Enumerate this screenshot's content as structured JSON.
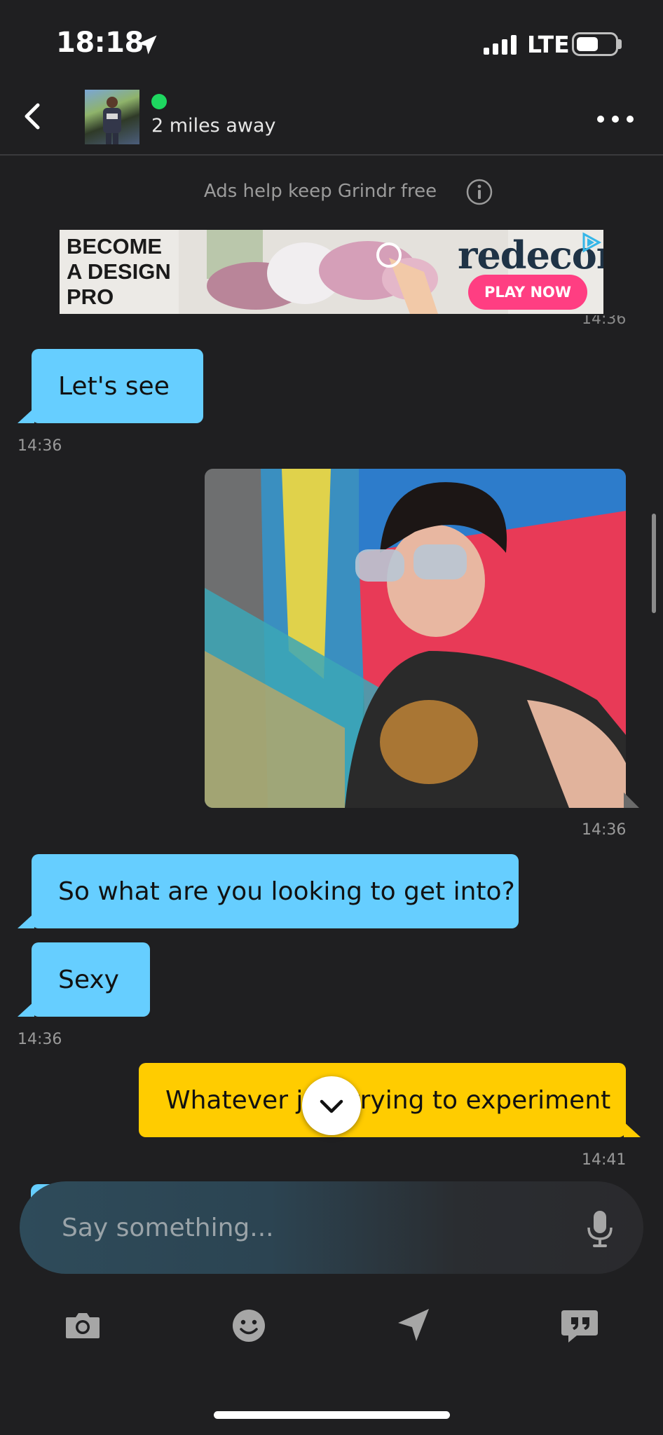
{
  "status_bar": {
    "time": "18:18",
    "network": "LTE"
  },
  "header": {
    "distance": "2 miles away",
    "online": true
  },
  "ad": {
    "note": "Ads help keep Grindr free",
    "headline_line1": "BECOME",
    "headline_line2": "A DESIGN",
    "headline_line3": "PRO",
    "brand": "redecor",
    "cta": "PLAY NOW"
  },
  "messages": [
    {
      "direction": "in",
      "text": "Let's see",
      "time": "14:36"
    },
    {
      "direction": "out",
      "type": "photo",
      "time": "14:36"
    },
    {
      "direction": "in",
      "text": "So what are you looking to get into?"
    },
    {
      "direction": "in",
      "text": "Sexy",
      "time": "14:36"
    },
    {
      "direction": "out",
      "text": "Whatever just trying to experiment",
      "time": "14:41"
    }
  ],
  "composer": {
    "placeholder": "Say something..."
  },
  "icons": [
    "back-icon",
    "more-icon",
    "info-icon",
    "chevron-down-icon",
    "mic-icon",
    "camera-icon",
    "emoji-icon",
    "location-icon",
    "saved-phrases-icon"
  ],
  "colors": {
    "background": "#1f1f21",
    "incoming": "#66ceff",
    "outgoing": "#ffcc00",
    "online": "#1ed760",
    "ad_cta": "#ff3e82"
  }
}
